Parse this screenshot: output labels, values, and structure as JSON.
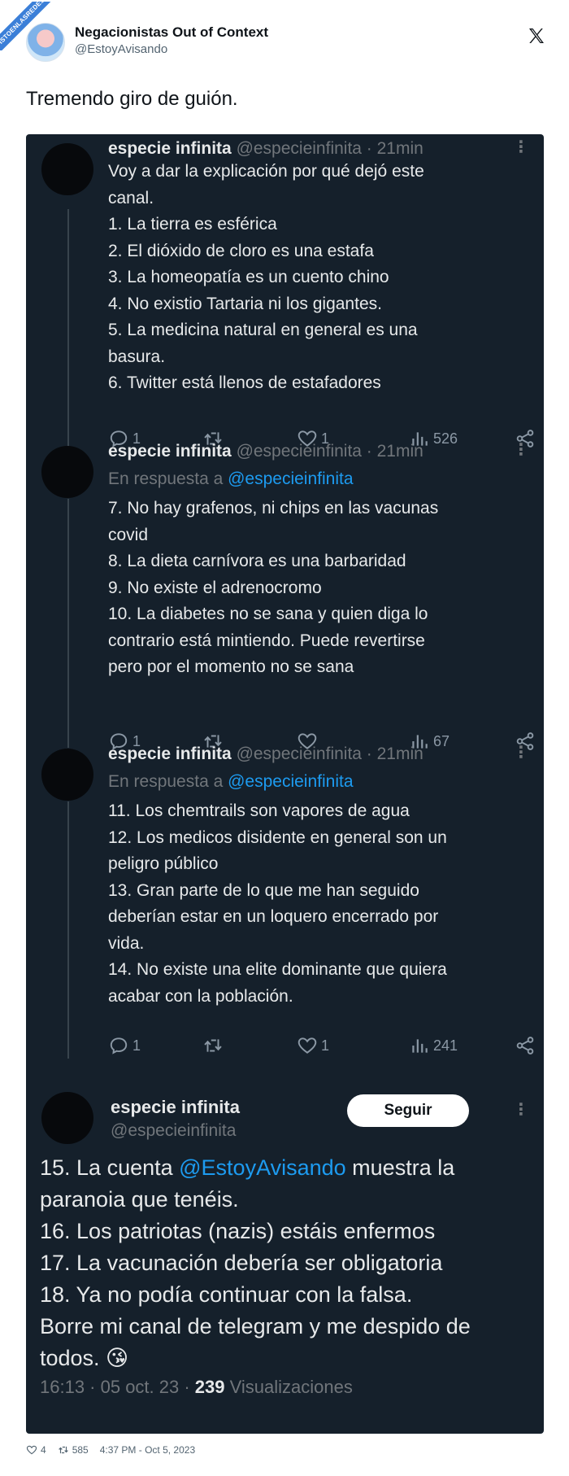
{
  "watermark": "VISTOENLASREDES",
  "header": {
    "display_name": "Negacionistas Out of Context",
    "handle": "@EstoyAvisando"
  },
  "caption": "Tremendo giro de guión.",
  "tweets": [
    {
      "name": "especie infinita",
      "meta": "@especieinfinita · 21min",
      "lines": [
        "Voy a dar la explicación por qué dejó este",
        "canal.",
        "1. La tierra es esférica",
        "2. El dióxido de cloro es una estafa",
        "3. La homeopatía es un cuento chino",
        "4. No existio Tartaria ni los gigantes.",
        "5. La medicina natural en general es una",
        "basura.",
        "6. Twitter está llenos de estafadores"
      ],
      "replies": "1",
      "retweets": "",
      "likes": "1",
      "views": "526"
    },
    {
      "name": "especie infinita",
      "meta": "@especieinfinita · 21min",
      "reply_prefix": "En respuesta a ",
      "reply_to": "@especieinfinita",
      "lines": [
        "7. No hay grafenos, ni chips en las vacunas",
        "covid",
        "8. La dieta carnívora es una barbaridad",
        "9. No existe el adrenocromo",
        "10. La diabetes no se sana y quien diga lo",
        "contrario está mintiendo. Puede revertirse",
        "pero por el momento no se sana"
      ],
      "replies": "1",
      "retweets": "",
      "likes": "",
      "views": "67"
    },
    {
      "name": "especie infinita",
      "meta": "@especieinfinita · 21min",
      "reply_prefix": "En respuesta a ",
      "reply_to": "@especieinfinita",
      "lines": [
        "11. Los chemtrails son vapores de agua",
        "12. Los medicos disidente en general son un",
        "peligro público",
        "13. Gran parte de lo que me han seguido",
        "deberían estar en un loquero encerrado por",
        "vida.",
        "14. No existe una elite dominante que quiera",
        "acabar con la población."
      ],
      "replies": "1",
      "retweets": "",
      "likes": "1",
      "views": "241"
    }
  ],
  "main_tweet": {
    "name": "especie infinita",
    "handle": "@especieinfinita",
    "follow_label": "Seguir",
    "line1_prefix": "15. La cuenta ",
    "line1_mention": "@EstoyAvisando",
    "line1_suffix": " muestra la",
    "lines": [
      "paranoia que tenéis.",
      "16. Los patriotas (nazis) estáis enfermos",
      "17. La vacunación debería ser obligatoria",
      "18. Ya no podía continuar con la falsa.",
      "Borre mi canal de telegram y me despido de",
      "todos. 😘"
    ],
    "time": "16:13 · 05 oct. 23 · ",
    "views_count": "239",
    "views_label": " Visualizaciones"
  },
  "footer": {
    "likes": "4",
    "retweets": "585",
    "timestamp": "4:37 PM - Oct 5, 2023"
  },
  "colors": {
    "dark_bg": "#15202b",
    "accent": "#1d9bf0",
    "text_dark": "#e7e9ea",
    "muted": "#71767b"
  }
}
